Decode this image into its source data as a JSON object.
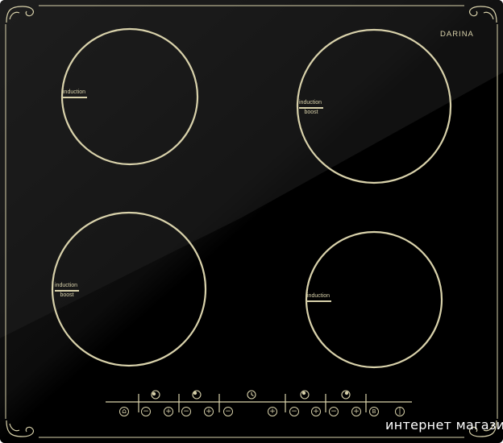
{
  "brand": "DARINA",
  "zones": {
    "top_left": {
      "label": "induction"
    },
    "top_right": {
      "label": "induction",
      "sublabel": "boost"
    },
    "bottom_left": {
      "label": "induction",
      "sublabel": "boost"
    },
    "bottom_right": {
      "label": "induction"
    }
  },
  "controls": {
    "lock": {
      "icon": "lock-icon",
      "glyph": "⌂"
    },
    "zone1_minus": {
      "icon": "minus-icon",
      "glyph": "−"
    },
    "zone1_plus": {
      "icon": "plus-icon",
      "glyph": "+"
    },
    "zone2_minus": {
      "icon": "minus-icon",
      "glyph": "−"
    },
    "zone2_plus": {
      "icon": "plus-icon",
      "glyph": "+"
    },
    "timer_minus": {
      "icon": "minus-icon",
      "glyph": "−"
    },
    "timer_plus": {
      "icon": "plus-icon",
      "glyph": "+"
    },
    "zone3_minus": {
      "icon": "minus-icon",
      "glyph": "−"
    },
    "zone3_plus": {
      "icon": "plus-icon",
      "glyph": "+"
    },
    "zone4_minus": {
      "icon": "minus-icon",
      "glyph": "−"
    },
    "zone4_plus": {
      "icon": "plus-icon",
      "glyph": "+"
    },
    "boost": {
      "icon": "boost-icon",
      "glyph": "B"
    },
    "power": {
      "icon": "power-icon",
      "glyph": "|"
    }
  },
  "indicators": {
    "zone1": "zone-selector-icon",
    "zone2": "zone-selector-icon",
    "timer": "clock-icon",
    "zone3": "zone-selector-icon",
    "zone4": "zone-selector-icon"
  },
  "watermark": "интернет магазин",
  "colors": {
    "glass": "#000000",
    "trim": "#d9d2ab"
  }
}
